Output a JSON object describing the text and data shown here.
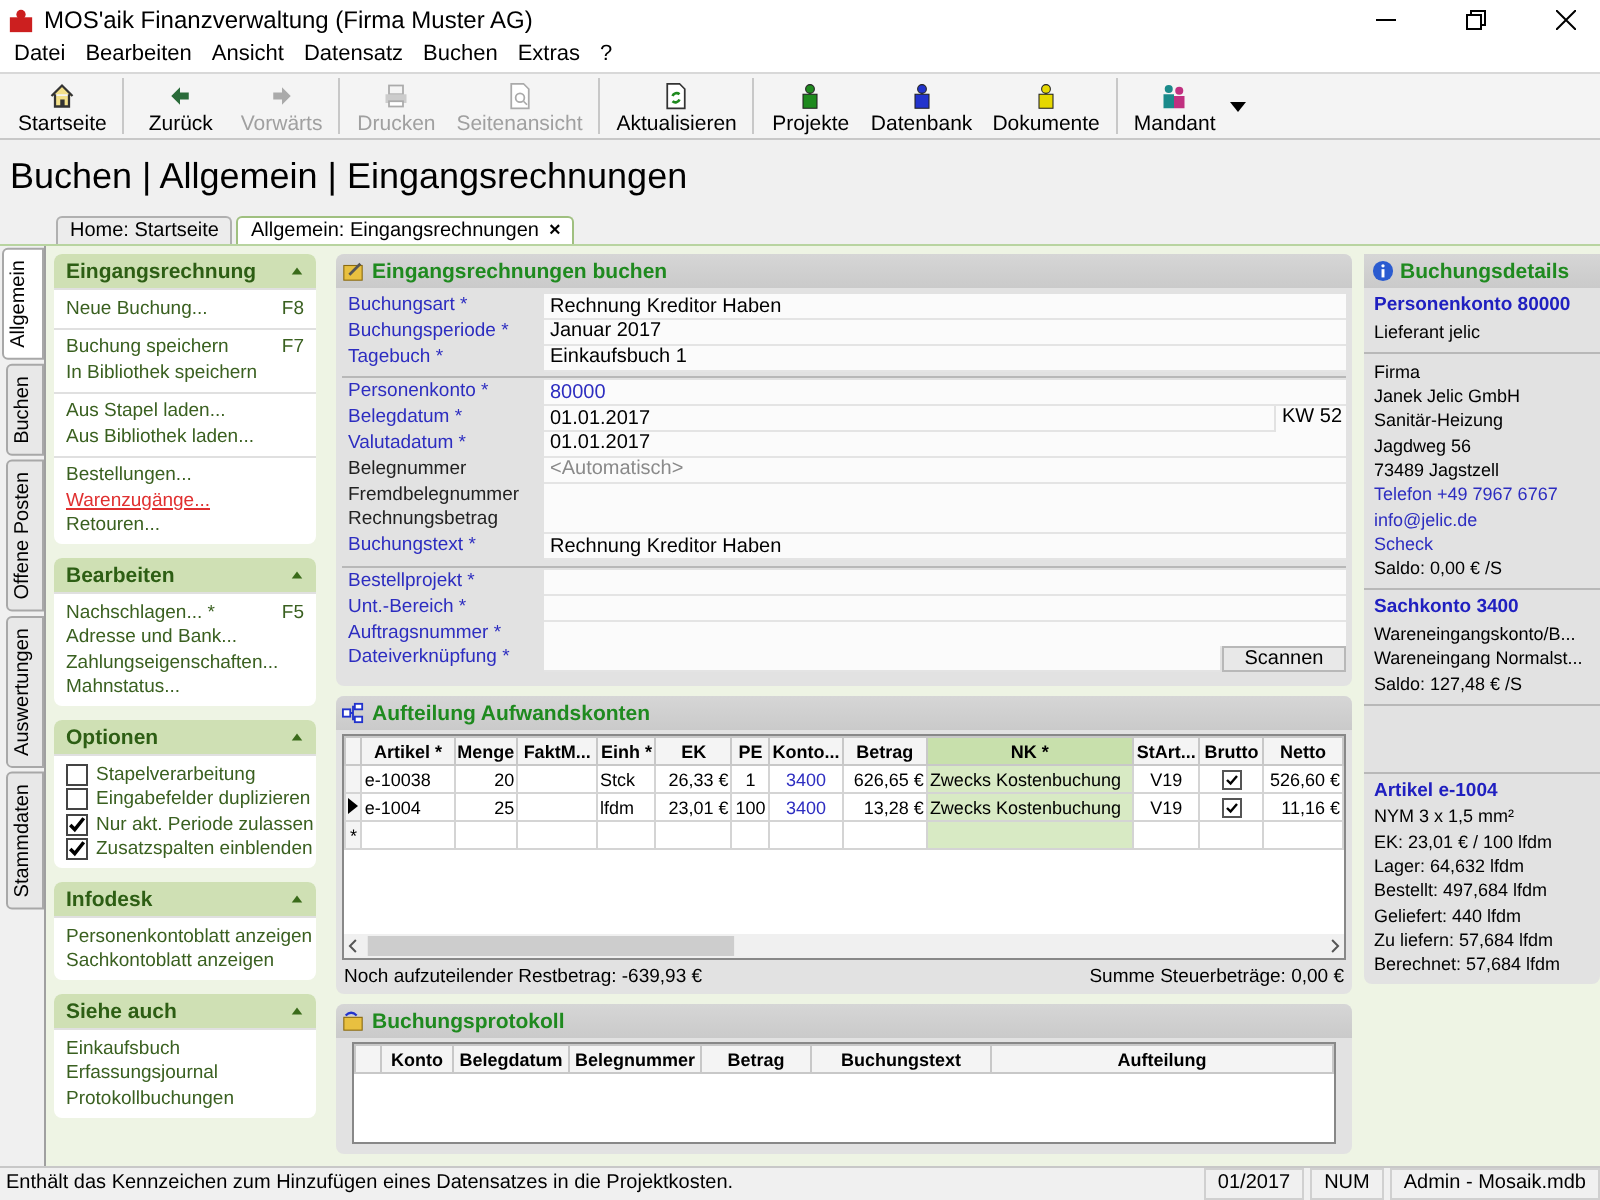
{
  "window": {
    "title": "MOS'aik Finanzverwaltung (Firma Muster AG)"
  },
  "menu": [
    "Datei",
    "Bearbeiten",
    "Ansicht",
    "Datensatz",
    "Buchen",
    "Extras",
    "?"
  ],
  "toolbar": {
    "groups": [
      [
        {
          "label": "Startseite",
          "kind": "home",
          "disabled": false,
          "dropdown": false
        }
      ],
      [
        {
          "label": "Zurück",
          "kind": "back",
          "disabled": false,
          "dropdown": false
        },
        {
          "label": "Vorwärts",
          "kind": "forward",
          "disabled": true,
          "dropdown": false
        }
      ],
      [
        {
          "label": "Drucken",
          "kind": "print",
          "disabled": true,
          "dropdown": false
        },
        {
          "label": "Seitenansicht",
          "kind": "preview",
          "disabled": true,
          "dropdown": false
        }
      ],
      [
        {
          "label": "Aktualisieren",
          "kind": "refresh",
          "disabled": false,
          "dropdown": false
        }
      ],
      [
        {
          "label": "Projekte",
          "kind": "puzzle",
          "color": "#1f8a1f",
          "disabled": false,
          "dropdown": false
        },
        {
          "label": "Datenbank",
          "kind": "puzzle",
          "color": "#2233cc",
          "disabled": false,
          "dropdown": false
        },
        {
          "label": "Dokumente",
          "kind": "puzzle",
          "color": "#e6d800",
          "disabled": false,
          "dropdown": false
        }
      ],
      [
        {
          "label": "Mandant",
          "kind": "people",
          "disabled": false,
          "dropdown": true
        }
      ]
    ]
  },
  "heading": "Buchen | Allgemein | Eingangsrechnungen",
  "doc_tabs": [
    {
      "label": "Home: Startseite",
      "selected": false
    },
    {
      "label": "Allgemein: Eingangsrechnungen",
      "selected": true,
      "close": "×"
    }
  ],
  "side_tabs": [
    {
      "label": "Allgemein",
      "selected": true
    },
    {
      "label": "Buchen",
      "selected": false
    },
    {
      "label": "Offene Posten",
      "selected": false
    },
    {
      "label": "Auswertungen",
      "selected": false
    },
    {
      "label": "Stammdaten",
      "selected": false
    }
  ],
  "task_pane": [
    {
      "title": "Eingangsrechnung",
      "expanded": true,
      "groups": [
        [
          {
            "kind": "link",
            "label": "Neue Buchung...",
            "shortcut": "F8",
            "hovered": false
          }
        ],
        [
          {
            "kind": "link",
            "label": "Buchung speichern",
            "shortcut": "F7",
            "hovered": false
          },
          {
            "kind": "link",
            "label": "In Bibliothek speichern",
            "hovered": false
          }
        ],
        [
          {
            "kind": "link",
            "label": "Aus Stapel laden...",
            "hovered": false
          },
          {
            "kind": "link",
            "label": "Aus Bibliothek laden...",
            "hovered": false
          }
        ],
        [
          {
            "kind": "link",
            "label": "Bestellungen...",
            "hovered": false
          },
          {
            "kind": "link",
            "label": "Warenzugänge...",
            "hovered": true
          },
          {
            "kind": "link",
            "label": "Retouren...",
            "hovered": false
          }
        ]
      ]
    },
    {
      "title": "Bearbeiten",
      "expanded": true,
      "groups": [
        [
          {
            "kind": "link",
            "label": "Nachschlagen... *",
            "shortcut": "F5",
            "hovered": false
          },
          {
            "kind": "link",
            "label": "Adresse und Bank...",
            "hovered": false
          },
          {
            "kind": "link",
            "label": "Zahlungseigenschaften...",
            "hovered": false
          },
          {
            "kind": "link",
            "label": "Mahnstatus...",
            "hovered": false
          }
        ]
      ]
    },
    {
      "title": "Optionen",
      "expanded": true,
      "groups": [
        [
          {
            "kind": "checkbox",
            "label": "Stapelverarbeitung",
            "checked": false
          },
          {
            "kind": "checkbox",
            "label": "Eingabefelder duplizieren",
            "checked": false
          },
          {
            "kind": "checkbox",
            "label": "Nur akt. Periode zulassen",
            "checked": true
          },
          {
            "kind": "checkbox",
            "label": "Zusatzspalten einblenden",
            "checked": true
          }
        ]
      ]
    },
    {
      "title": "Infodesk",
      "expanded": true,
      "groups": [
        [
          {
            "kind": "link",
            "label": "Personenkontoblatt anzeigen",
            "hovered": false
          },
          {
            "kind": "link",
            "label": "Sachkontoblatt anzeigen",
            "hovered": false
          }
        ]
      ]
    },
    {
      "title": "Siehe auch",
      "expanded": true,
      "groups": [
        [
          {
            "kind": "link",
            "label": "Einkaufsbuch",
            "hovered": false
          },
          {
            "kind": "link",
            "label": "Erfassungsjournal",
            "hovered": false
          },
          {
            "kind": "link",
            "label": "Protokollbuchungen",
            "hovered": false
          }
        ]
      ]
    }
  ],
  "booking_form": {
    "title": "Eingangsrechnungen buchen",
    "sections": [
      [
        {
          "label": "Buchungsart *",
          "mandatory": true,
          "value": "Rechnung Kreditor Haben",
          "value_link": false
        },
        {
          "label": "Buchungsperiode *",
          "mandatory": true,
          "value": "Januar 2017",
          "value_link": false
        },
        {
          "label": "Tagebuch *",
          "mandatory": true,
          "value": "Einkaufsbuch 1",
          "value_link": false
        }
      ],
      [
        {
          "label": "Personenkonto *",
          "mandatory": true,
          "value": "80000",
          "value_link": true
        },
        {
          "label": "Belegdatum *",
          "mandatory": true,
          "value": "01.01.2017",
          "value_link": false,
          "suffix": "KW 52"
        },
        {
          "label": "Valutadatum *",
          "mandatory": true,
          "value": "01.01.2017",
          "value_link": false
        },
        {
          "label": "Belegnummer",
          "mandatory": false,
          "placeholder": "<Automatisch>"
        },
        {
          "label": "Fremdbelegnummer",
          "mandatory": false
        },
        {
          "label": "Rechnungsbetrag",
          "mandatory": false
        },
        {
          "label": "Buchungstext *",
          "mandatory": true,
          "value": "Rechnung Kreditor Haben",
          "value_link": false
        }
      ],
      [
        {
          "label": "Bestellprojekt *",
          "mandatory": true
        },
        {
          "label": "Unt.-Bereich *",
          "mandatory": true
        },
        {
          "label": "Auftragsnummer *",
          "mandatory": true
        },
        {
          "label": "Dateiverknüpfung *",
          "mandatory": true,
          "button": "Scannen"
        }
      ]
    ]
  },
  "split": {
    "title": "Aufteilung Aufwandskonten",
    "columns": [
      {
        "label": "Artikel *",
        "highlighted": false
      },
      {
        "label": "Menge",
        "highlighted": false
      },
      {
        "label": "FaktM...",
        "highlighted": false
      },
      {
        "label": "Einh *",
        "highlighted": false
      },
      {
        "label": "EK",
        "highlighted": false
      },
      {
        "label": "PE",
        "highlighted": false
      },
      {
        "label": "Konto...",
        "highlighted": false
      },
      {
        "label": "Betrag",
        "highlighted": false
      },
      {
        "label": "NK *",
        "highlighted": true
      },
      {
        "label": "StArt...",
        "highlighted": false
      },
      {
        "label": "Brutto",
        "highlighted": false
      },
      {
        "label": "Netto",
        "highlighted": false
      }
    ],
    "rows": [
      {
        "selected": false,
        "artikel": "e-10038",
        "menge": "20",
        "einh": "Stck",
        "ek": "26,33 €",
        "pe": "1",
        "konto": "3400",
        "betrag": "626,65 €",
        "nk": "Zwecks Kostenbuchung",
        "start": "V19",
        "brutto": true,
        "netto": "526,60 €"
      },
      {
        "selected": true,
        "artikel": "e-1004",
        "menge": "25",
        "einh": "lfdm",
        "ek": "23,01 €",
        "pe": "100",
        "konto": "3400",
        "betrag": "13,28 €",
        "nk": "Zwecks Kostenbuchung",
        "start": "V19",
        "brutto": true,
        "netto": "11,16 €"
      }
    ],
    "new_row_marker": "*",
    "rest": "Noch aufzuteilender Restbetrag: -639,93 €",
    "tax_sum": "Summe Steuerbeträge: 0,00 €"
  },
  "protocol": {
    "title": "Buchungsprotokoll",
    "columns": [
      "Konto",
      "Belegdatum",
      "Belegnummer",
      "Betrag",
      "Buchungstext",
      "Aufteilung"
    ]
  },
  "details": {
    "title": "Buchungsdetails",
    "sections": [
      [
        {
          "kind": "heading",
          "text": "Personenkonto 80000"
        },
        {
          "kind": "plain",
          "text": "Lieferant jelic"
        }
      ],
      [
        {
          "kind": "plain",
          "text": "Firma"
        },
        {
          "kind": "plain",
          "text": "Janek Jelic GmbH"
        },
        {
          "kind": "plain",
          "text": "Sanitär-Heizung"
        },
        {
          "kind": "plain",
          "text": "Jagdweg 56"
        },
        {
          "kind": "plain",
          "text": "73489 Jagstzell"
        },
        {
          "kind": "link",
          "text": "Telefon +49 7967 6767"
        },
        {
          "kind": "link",
          "text": "info@jelic.de"
        },
        {
          "kind": "link",
          "text": "Scheck"
        },
        {
          "kind": "plain",
          "text": "Saldo: 0,00 € /S"
        }
      ],
      [
        {
          "kind": "heading",
          "text": "Sachkonto 3400"
        },
        {
          "kind": "plain",
          "text": "Wareneingangskonto/B..."
        },
        {
          "kind": "plain",
          "text": "Wareneingang Normalst..."
        },
        {
          "kind": "plain",
          "text": "Saldo: 127,48 € /S"
        }
      ],
      [
        {
          "kind": "heading",
          "text": "Artikel e-1004"
        },
        {
          "kind": "plain",
          "text": "NYM 3 x 1,5 mm²"
        },
        {
          "kind": "plain",
          "text": "EK: 23,01 € / 100 lfdm"
        },
        {
          "kind": "plain",
          "text": "Lager: 64,632 lfdm"
        },
        {
          "kind": "plain",
          "text": "Bestellt: 497,684 lfdm"
        },
        {
          "kind": "plain",
          "text": "Geliefert: 440 lfdm"
        },
        {
          "kind": "plain",
          "text": "Zu liefern: 57,684 lfdm"
        },
        {
          "kind": "plain",
          "text": "Berechnet: 57,684 lfdm"
        }
      ]
    ]
  },
  "status_bar": {
    "message": "Enthält das Kennzeichen zum Hinzufügen eines Datensatzes in die Projektkosten.",
    "period": "01/2017",
    "num": "NUM",
    "user": "Admin - Mosaik.mdb"
  }
}
